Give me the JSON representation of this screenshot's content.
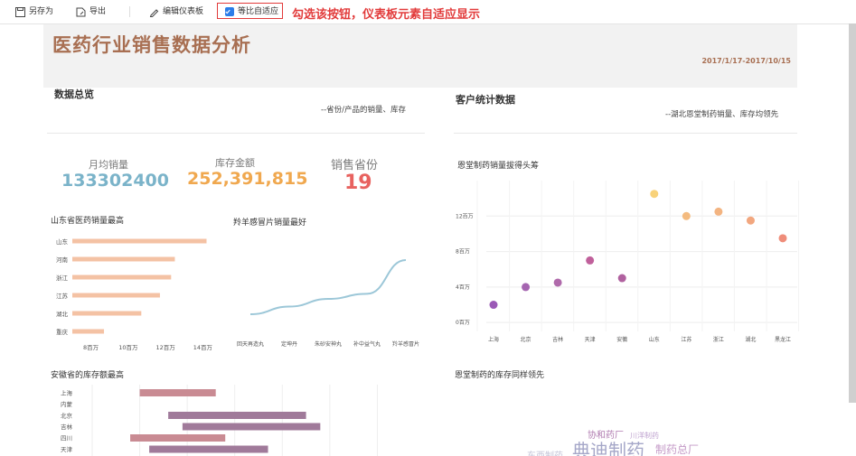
{
  "toolbar": {
    "save_as": "另存为",
    "export": "导出",
    "edit_dashboard": "编辑仪表板",
    "proportional": "等比自适应",
    "annotation": "勾选该按钮，仪表板元素自适应显示"
  },
  "dashboard": {
    "title": "医药行业销售数据分析",
    "date_range": "2017/1/17-2017/10/15"
  },
  "data_overview": {
    "title": "数据总览",
    "subtitle": "--省份/产品的销量、库存",
    "kpis": [
      {
        "label": "月均销量",
        "value": "133302400",
        "color": "#7ab3c9"
      },
      {
        "label": "库存金额",
        "value": "252,391,815",
        "color": "#f0a84f"
      },
      {
        "label": "销售省份",
        "value": "19",
        "color": "#e8625f"
      }
    ]
  },
  "customer_stats": {
    "title": "客户统计数据",
    "subtitle": "--湖北恩堂制药销量、库存均领先"
  },
  "chart_data": [
    {
      "type": "bar",
      "title": "山东省医药销量最高",
      "orientation": "horizontal",
      "categories": [
        "山东",
        "河南",
        "浙江",
        "江苏",
        "湖北",
        "重庆"
      ],
      "values": [
        14.2,
        12.5,
        12.3,
        11.7,
        10.7,
        8.7
      ],
      "x_ticks": [
        "8百万",
        "10百万",
        "12百万",
        "14百万"
      ],
      "xlim": [
        7,
        15
      ],
      "color": "#f4c2a4"
    },
    {
      "type": "line",
      "title": "羚羊感冒片销量最好",
      "categories": [
        "回天再造丸",
        "定坤丹",
        "朱砂安神丸",
        "补中益气丸",
        "羚羊感冒片"
      ],
      "values": [
        1,
        2.2,
        3.4,
        4.2,
        9.5
      ],
      "color": "#9cc7d8"
    },
    {
      "type": "scatter",
      "title": "恩堂制药销量拔得头筹",
      "categories": [
        "上海",
        "北京",
        "吉林",
        "天津",
        "安徽",
        "山东",
        "江苏",
        "浙江",
        "湖北",
        "黑龙江"
      ],
      "values": [
        2.0,
        4.0,
        4.5,
        7.0,
        5.0,
        14.5,
        12.0,
        12.5,
        11.5,
        9.5
      ],
      "colors": [
        "#9b59b6",
        "#a565b0",
        "#b06aab",
        "#c0609b",
        "#b0619f",
        "#f8d27a",
        "#f4bb7f",
        "#f3b481",
        "#f2a77f",
        "#ef8d7a"
      ],
      "y_ticks": [
        "0百万",
        "4百万",
        "8百万",
        "12百万"
      ],
      "ylim": [
        -1,
        16
      ]
    },
    {
      "type": "bar",
      "title": "安徽省的库存额最高",
      "orientation": "horizontal-range",
      "categories": [
        "上海",
        "内蒙",
        "北京",
        "吉林",
        "四川",
        "天津"
      ],
      "ranges": [
        [
          1.0,
          2.6
        ],
        [
          0,
          0
        ],
        [
          1.6,
          4.5
        ],
        [
          1.9,
          4.8
        ],
        [
          0.8,
          2.8
        ],
        [
          1.2,
          3.7
        ]
      ],
      "colors": [
        "#c98b93",
        "#c98b93",
        "#a07a9a",
        "#a07a9a",
        "#c98b93",
        "#a07a9a"
      ]
    },
    {
      "type": "table",
      "title": "恩堂制药的库存同样领先",
      "words": [
        "协和药厂",
        "川洋制药",
        "典迪制药",
        "制药总厂",
        "东西制药"
      ]
    }
  ]
}
